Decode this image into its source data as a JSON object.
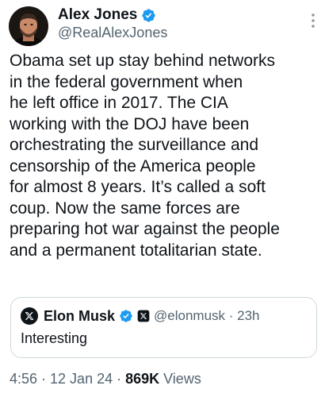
{
  "author": {
    "name": "Alex Jones",
    "handle": "@RealAlexJones",
    "verified_color": "#1d9bf0"
  },
  "tweet": {
    "text": "Obama set up stay behind networks\nin the federal government when\nhe left office in 2017. The CIA\nworking with the DOJ have been\norchestrating the surveillance and\ncensorship of the America people\nfor almost 8 years. It’s called a soft\ncoup. Now the same forces are\npreparing hot war against the people\nand a permanent totalitarian state."
  },
  "quote": {
    "name": "Elon Musk",
    "handle_time": "@elonmusk · 23h",
    "text": "Interesting"
  },
  "meta": {
    "time": "4:56 · 12 Jan 24 · ",
    "views_count": "869K",
    "views_label": " Views"
  },
  "icons": {
    "more": "more-vertical-icon",
    "verified": "verified-badge-icon",
    "x_logo": "x-logo-icon"
  },
  "colors": {
    "text_primary": "#0f1419",
    "text_secondary": "#536471",
    "border": "#cfd9de",
    "verified": "#1d9bf0"
  }
}
